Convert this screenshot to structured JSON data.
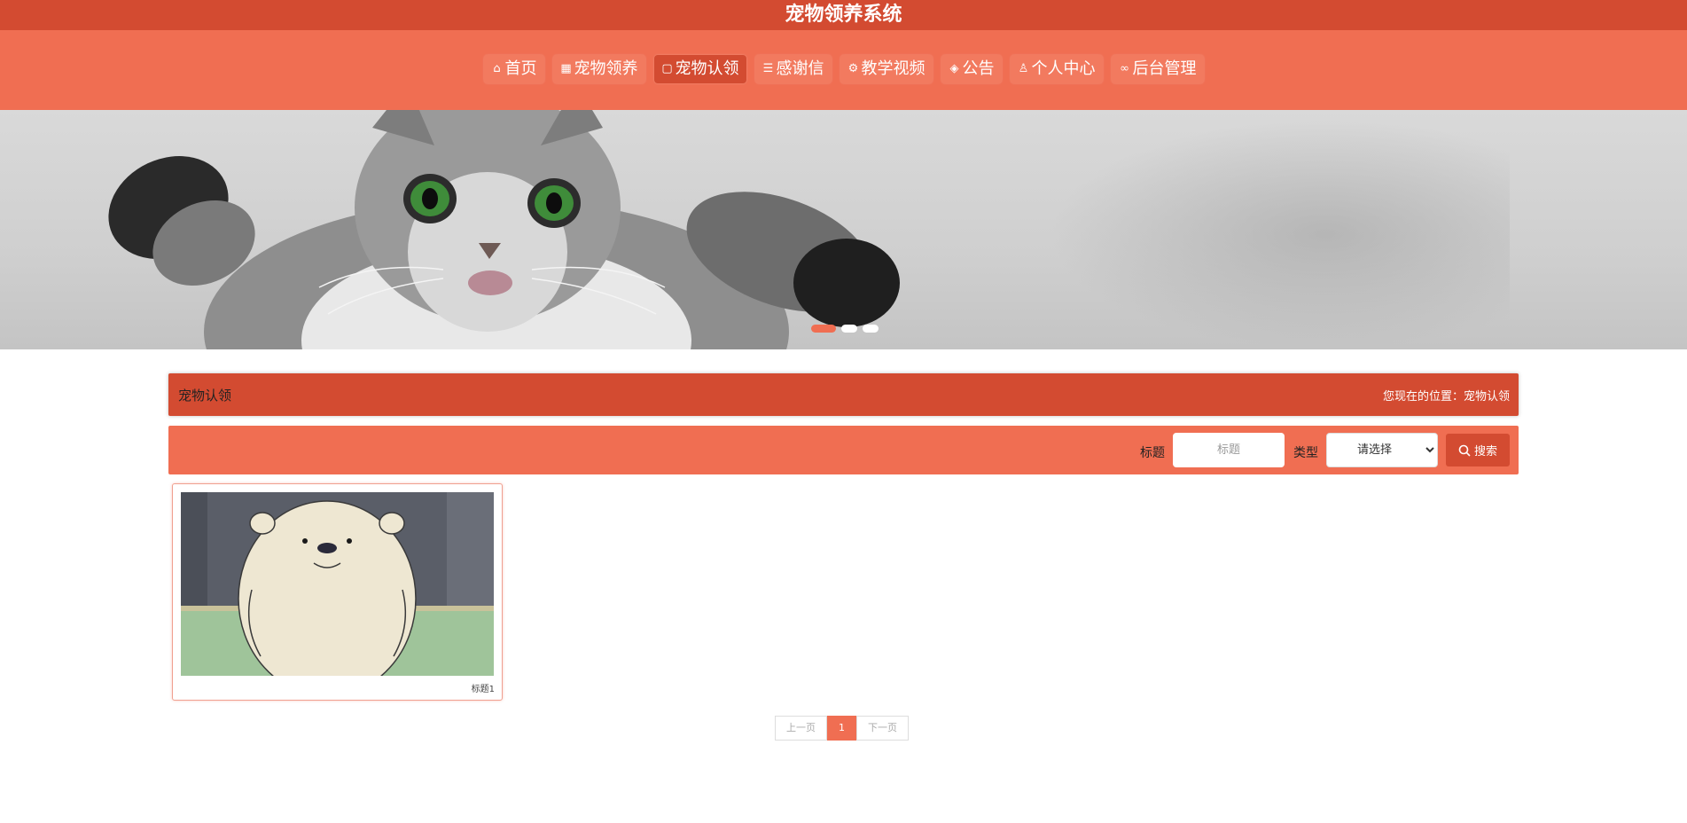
{
  "app": {
    "title": "宠物领养系统"
  },
  "nav": {
    "items": [
      {
        "label": "首页",
        "icon": "home-icon",
        "active": false
      },
      {
        "label": "宠物领养",
        "icon": "gift-icon",
        "active": false
      },
      {
        "label": "宠物认领",
        "icon": "file-icon",
        "active": true
      },
      {
        "label": "感谢信",
        "icon": "sliders-icon",
        "active": false
      },
      {
        "label": "教学视频",
        "icon": "gear-icon",
        "active": false
      },
      {
        "label": "公告",
        "icon": "cube-icon",
        "active": false
      },
      {
        "label": "个人中心",
        "icon": "user-icon",
        "active": false
      },
      {
        "label": "后台管理",
        "icon": "link-icon",
        "active": false
      }
    ]
  },
  "banner": {
    "slide_count": 3,
    "active_slide": 1
  },
  "page": {
    "title": "宠物认领",
    "location_label": "您现在的位置：",
    "location_value": "宠物认领"
  },
  "search": {
    "title_label": "标题",
    "title_placeholder": "标题",
    "type_label": "类型",
    "type_selected": "请选择",
    "button_label": "搜索"
  },
  "cards": [
    {
      "caption": "标题1"
    }
  ],
  "pagination": {
    "prev_label": "上一页",
    "current_page": "1",
    "next_label": "下一页"
  },
  "colors": {
    "primary": "#f06e52",
    "primary_dark": "#d34b31"
  }
}
